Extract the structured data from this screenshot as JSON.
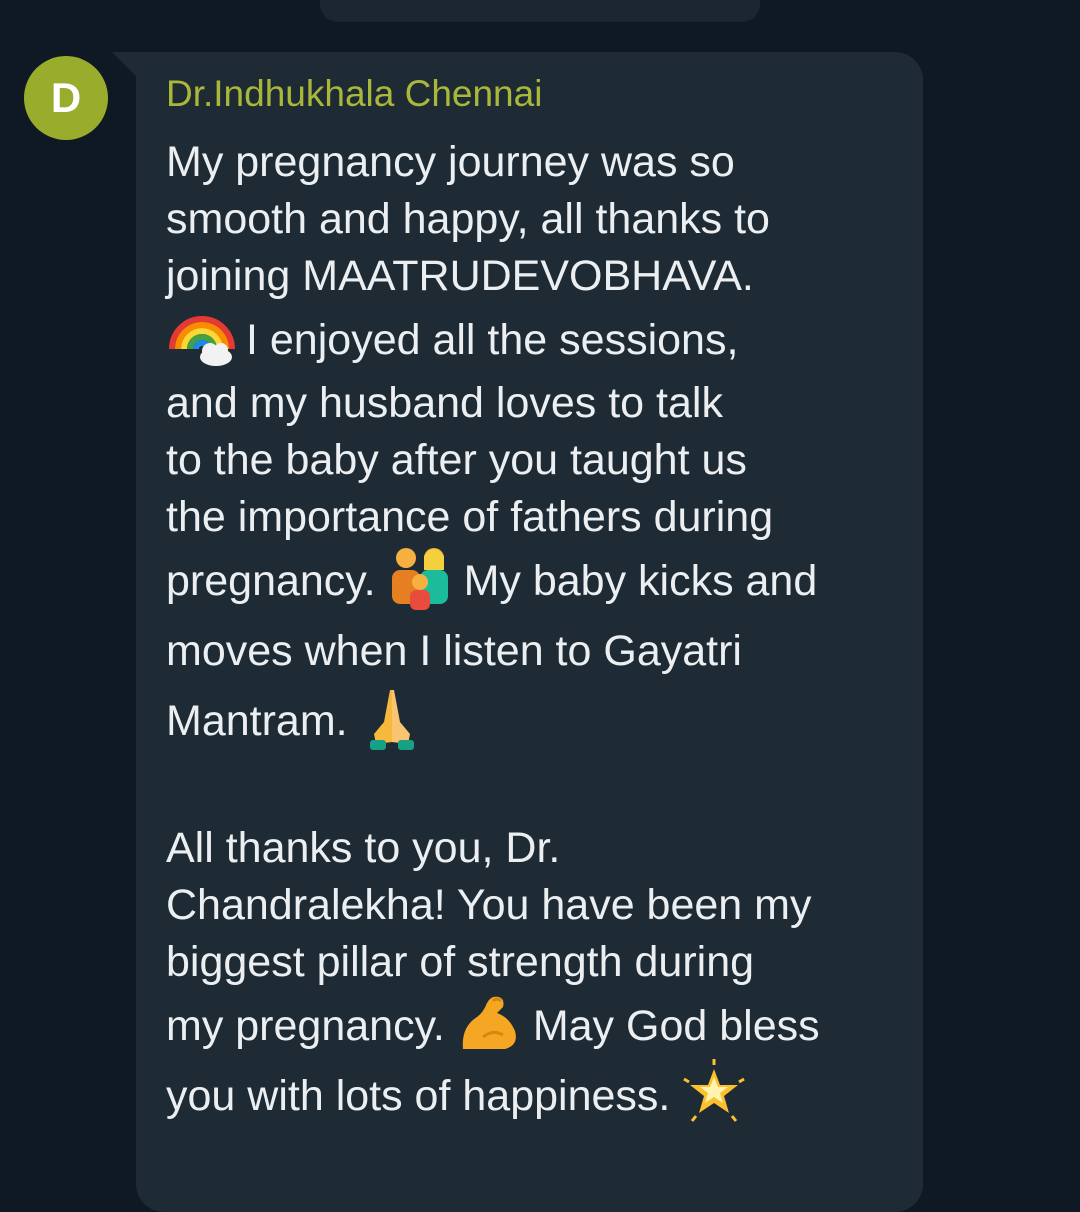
{
  "sender": {
    "avatar_letter": "D",
    "name": "Dr.Indhukhala Chennai",
    "avatar_color": "#9aac2c",
    "name_color": "#a9b83a"
  },
  "message": {
    "lines": [
      "My pregnancy journey was so",
      "smooth and happy, all thanks to",
      "joining MAATRUDEVOBHAVA.",
      "I enjoyed all the sessions,",
      "and my husband loves to talk",
      "to the baby after you taught us",
      "the importance of fathers during",
      "pregnancy.",
      "My baby kicks and",
      "moves when I listen to Gayatri",
      "Mantram.",
      "All thanks to you, Dr.",
      "Chandralekha! You have been my",
      "biggest pillar of strength during",
      "my pregnancy.",
      "May God bless",
      "you with lots of happiness."
    ],
    "emojis": {
      "rainbow": "rainbow-icon",
      "family": "family-icon",
      "pray": "folded-hands-icon",
      "muscle": "flexed-biceps-icon",
      "star": "glowing-star-icon"
    }
  },
  "colors": {
    "background": "#0f1923",
    "bubble": "#1f2b34",
    "text": "#eceff1"
  }
}
